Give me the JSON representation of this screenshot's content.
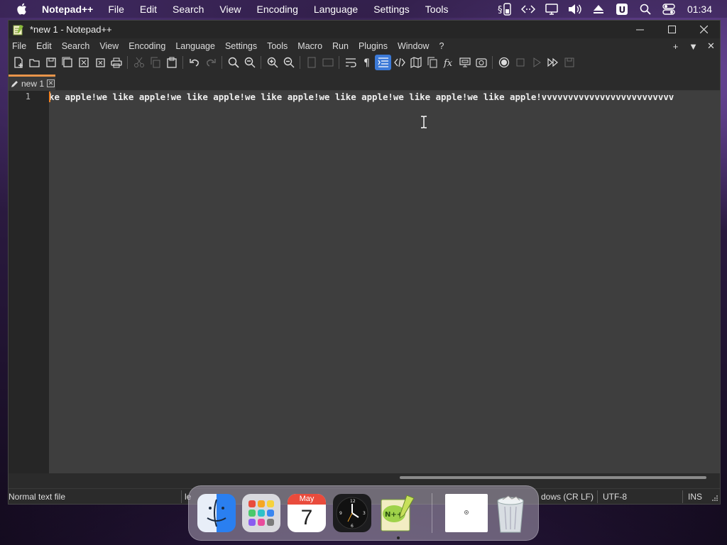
{
  "mac_menubar": {
    "app_name": "Notepad++",
    "items": [
      "File",
      "Edit",
      "Search",
      "View",
      "Encoding",
      "Language",
      "Settings",
      "Tools"
    ],
    "clock": "01:34",
    "status_icons": [
      "script-icon",
      "phone-icon",
      "code-arrows-icon",
      "display-icon",
      "volume-icon",
      "eject-icon",
      "u-icon",
      "search-icon",
      "control-center-icon"
    ]
  },
  "window": {
    "title": "*new 1 - Notepad++"
  },
  "np_menu": {
    "items": [
      "File",
      "Edit",
      "Search",
      "View",
      "Encoding",
      "Language",
      "Settings",
      "Tools",
      "Macro",
      "Run",
      "Plugins",
      "Window",
      "?"
    ],
    "right_controls": [
      "+",
      "▼",
      "✕"
    ]
  },
  "tab": {
    "label": "new 1"
  },
  "editor": {
    "line_number": "1",
    "line_text": "ke apple!we like apple!we like apple!we like apple!we like apple!we like apple!we like apple!vvvvvvvvvvvvvvvvvvvvvvvvv"
  },
  "statusbar": {
    "file_type": "Normal text file",
    "length_partial": "le",
    "eol_partial": "dows (CR LF)",
    "encoding": "UTF-8",
    "mode": "INS"
  },
  "dock": {
    "calendar_month": "May",
    "calendar_day": "7",
    "apps": [
      "finder-icon",
      "launchpad-icon",
      "calendar-icon",
      "clock-icon",
      "notepadpp-icon",
      "document-preview-icon",
      "trash-icon"
    ]
  },
  "colors": {
    "accent_tab": "#e8944a",
    "caret": "#f08020",
    "editor_bg": "#3e3e3e",
    "active_tool": "#3c7ad8"
  }
}
